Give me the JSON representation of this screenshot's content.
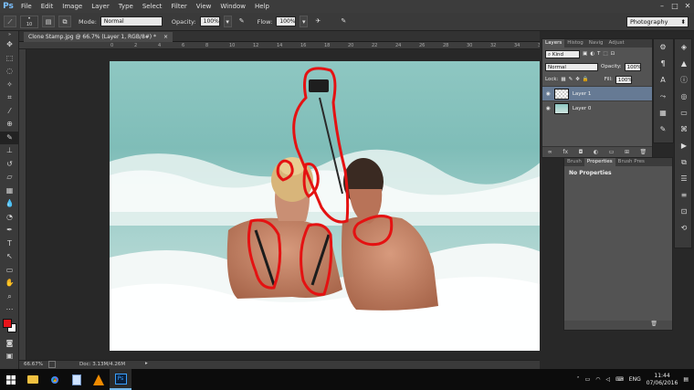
{
  "app": {
    "logo": "Ps"
  },
  "menu": [
    "File",
    "Edit",
    "Image",
    "Layer",
    "Type",
    "Select",
    "Filter",
    "View",
    "Window",
    "Help"
  ],
  "window_controls": [
    "–",
    "□",
    "✕"
  ],
  "options": {
    "brush_size": "10",
    "mode_label": "Mode:",
    "mode_value": "Normal",
    "opacity_label": "Opacity:",
    "opacity_value": "100%",
    "flow_label": "Flow:",
    "flow_value": "100%",
    "workspace": "Photography"
  },
  "document": {
    "tab_title": "Clone Stamp.jpg @ 66.7% (Layer 1, RGB/8#) *",
    "ruler_ticks": [
      "0",
      "2",
      "4",
      "6",
      "8",
      "10",
      "12",
      "14",
      "16",
      "18",
      "20",
      "22",
      "24",
      "26",
      "28",
      "30",
      "32",
      "34",
      "36"
    ],
    "zoom": "66.67%",
    "doc_info": "Doc: 3.13M/4.26M"
  },
  "layers_panel": {
    "tabs": [
      "Layers",
      "Histog",
      "Navig",
      "Adjust"
    ],
    "kind_label": "Kind",
    "blend_mode": "Normal",
    "opacity_label": "Opacity:",
    "opacity_value": "100%",
    "lock_label": "Lock:",
    "fill_label": "Fill:",
    "fill_value": "100%",
    "layers": [
      {
        "name": "Layer 1",
        "active": true
      },
      {
        "name": "Layer 0",
        "active": false
      }
    ]
  },
  "properties_panel": {
    "tabs": [
      "Brush",
      "Properties",
      "Brush Pres"
    ],
    "message": "No Properties"
  },
  "colors": {
    "foreground": "#e8141a",
    "background": "#ffffff",
    "annotation": "#e41212",
    "accent": "#667a94"
  },
  "taskbar": {
    "language": "ENG",
    "time": "11:44",
    "date": "07/06/2016"
  }
}
